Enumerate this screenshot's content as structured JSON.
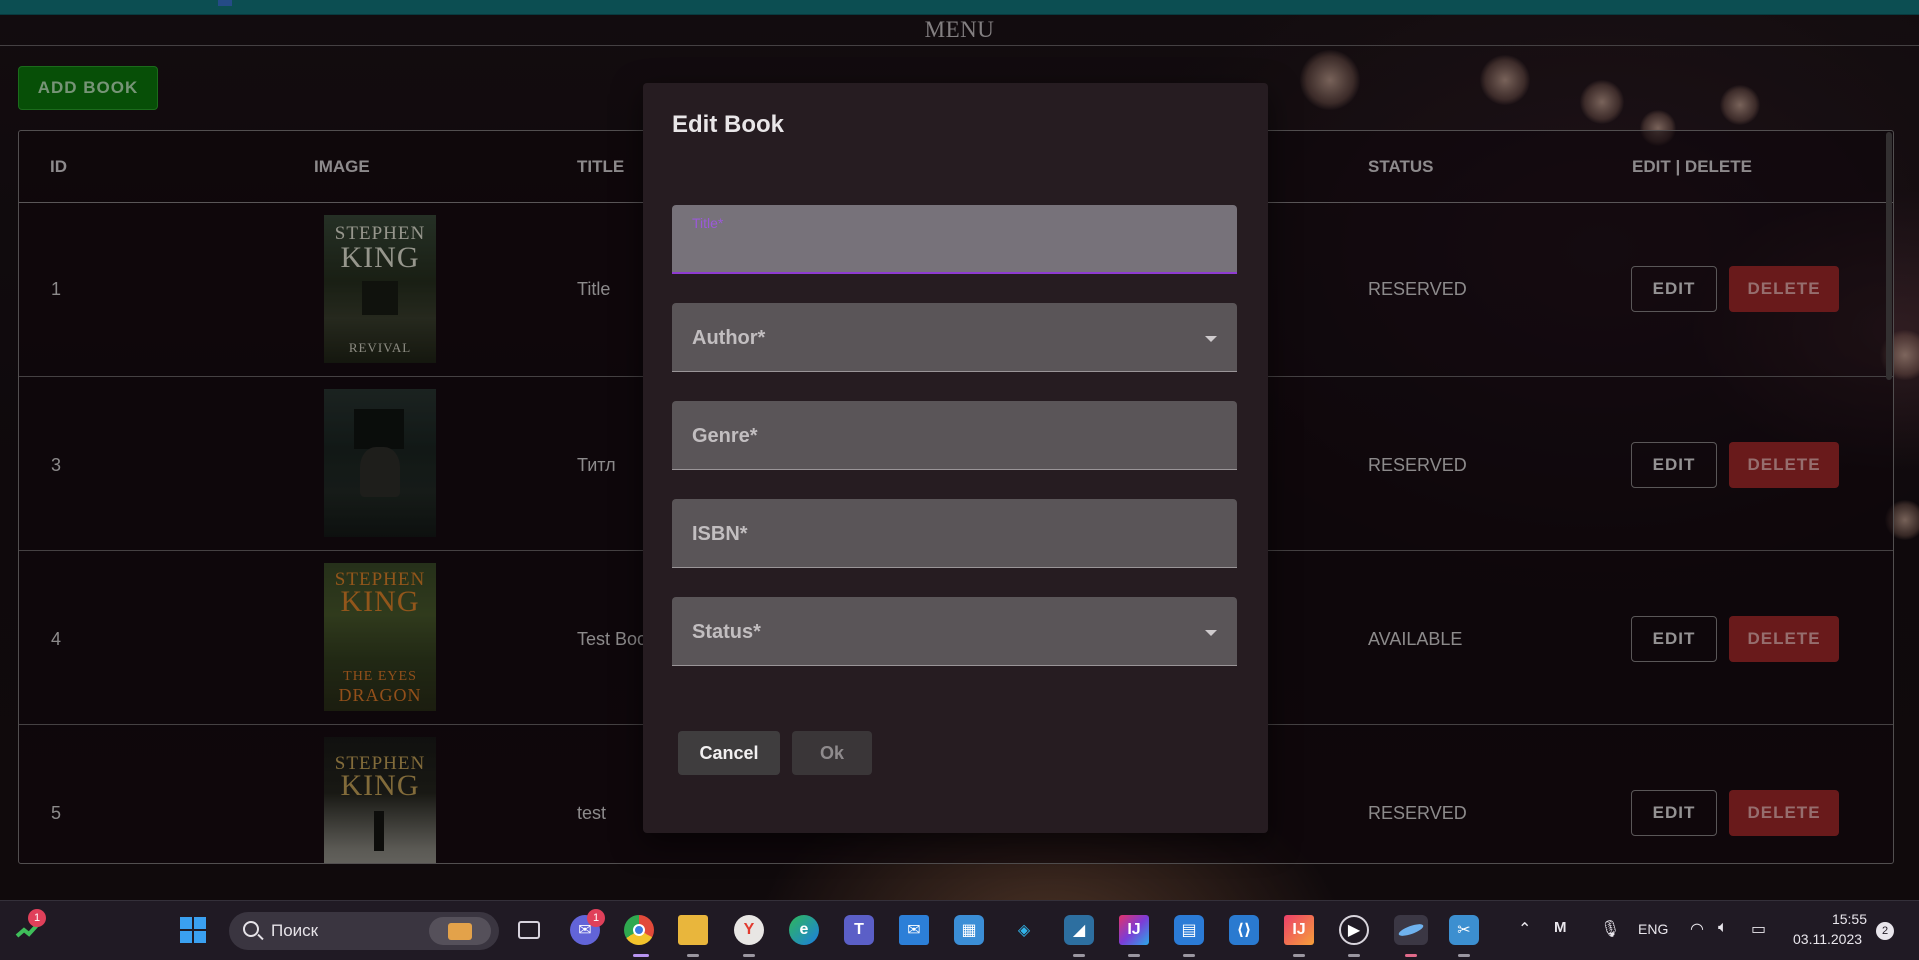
{
  "menu": {
    "title": "MENU"
  },
  "toolbar": {
    "add_label": "ADD BOOK"
  },
  "table": {
    "headers": [
      "ID",
      "IMAGE",
      "TITLE",
      "STATUS",
      "EDIT | DELETE"
    ],
    "rows": [
      {
        "id": "1",
        "title": "Title",
        "status": "RESERVED",
        "edit": "EDIT",
        "delete": "DELETE",
        "cover_author": "STEPHEN KING",
        "cover_title": "REVIVAL"
      },
      {
        "id": "3",
        "title": "Титл",
        "status": "RESERVED",
        "edit": "EDIT",
        "delete": "DELETE",
        "cover_author": "",
        "cover_title": ""
      },
      {
        "id": "4",
        "title": "Test Boo",
        "status": "AVAILABLE",
        "edit": "EDIT",
        "delete": "DELETE",
        "cover_author": "STEPHEN KING",
        "cover_title": "THE EYES OF THE DRAGON"
      },
      {
        "id": "5",
        "title": "test",
        "status": "RESERVED",
        "edit": "EDIT",
        "delete": "DELETE",
        "cover_author": "STEPHEN KING",
        "cover_title": ""
      }
    ]
  },
  "dialog": {
    "title": "Edit Book",
    "fields": {
      "title": "Title*",
      "author": "Author*",
      "genre": "Genre*",
      "isbn": "ISBN*",
      "status": "Status*"
    },
    "cancel": "Cancel",
    "ok": "Ok"
  },
  "taskbar": {
    "search_text": "Поиск",
    "lang": "ENG",
    "time": "15:55",
    "date": "03.11.2023",
    "notifications": "2",
    "stocks_badge": "1",
    "chat_badge": "1"
  },
  "colors": {
    "accent_focus": "#8e3bd1",
    "add_button": "#0b7a0b",
    "delete_button": "#a2282a",
    "topbar": "#13787f"
  }
}
